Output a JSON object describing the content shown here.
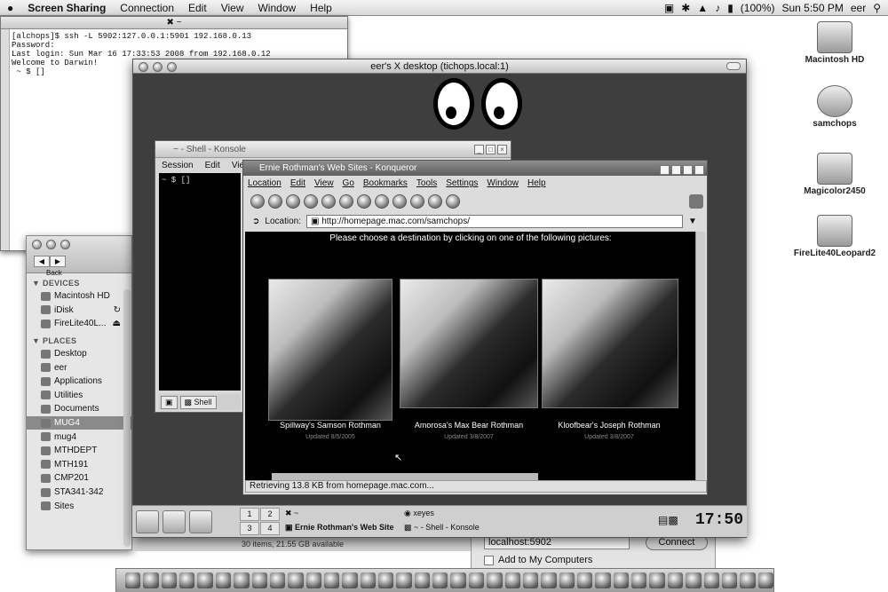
{
  "menubar": {
    "apple": "",
    "app": "Screen Sharing",
    "items": [
      "Connection",
      "Edit",
      "View",
      "Window",
      "Help"
    ],
    "battery": "(100%)",
    "clock": "Sun 5:50 PM",
    "user": "eer"
  },
  "desktop_icons": [
    "Macintosh HD",
    "samchops",
    "Magicolor2450",
    "FireLite40Leopard2"
  ],
  "xterm": {
    "title": "~",
    "lines": "[alchops]$ ssh -L 5902:127.0.0.1:5901 192.168.0.13\nPassword:\nLast login: Sun Mar 16 17:33:53 2008 from 192.168.0.12\nWelcome to Darwin!\n ~ $ []"
  },
  "finder": {
    "back_label": "Back",
    "devices_header": "DEVICES",
    "devices": [
      "Macintosh HD",
      "iDisk",
      "FireLite40L..."
    ],
    "places_header": "PLACES",
    "places": [
      "Desktop",
      "eer",
      "Applications",
      "Utilities",
      "Documents",
      "MUG4",
      "mug4",
      "MTHDEPT",
      "MTH191",
      "CMP201",
      "STA341-342",
      "Sites"
    ],
    "status": "30 items, 21.55 GB available"
  },
  "ss_dialog": {
    "host": "localhost:5902",
    "connect": "Connect",
    "checkbox": "Add to My Computers"
  },
  "xwindow": {
    "title": "eer's X desktop (tichops.local:1)"
  },
  "konsole": {
    "title": "~ - Shell - Konsole",
    "menu": [
      "Session",
      "Edit",
      "View"
    ],
    "prompt": "~ $ []",
    "tab": "Shell"
  },
  "konqueror": {
    "title": "Ernie Rothman's Web Sites - Konqueror",
    "menu": [
      "Location",
      "Edit",
      "View",
      "Go",
      "Bookmarks",
      "Tools",
      "Settings",
      "Window",
      "Help"
    ],
    "location_label": "Location:",
    "url": "http://homepage.mac.com/samchops/",
    "heading": "Please choose a destination by clicking on one of the following pictures:",
    "dogs": [
      {
        "name": "Spillway's Samson Rothman",
        "updated": "Updated 8/5/2005"
      },
      {
        "name": "Amorosa's Max Bear Rothman",
        "updated": "Updated 3/8/2007"
      },
      {
        "name": "Kloofbear's Joseph Rothman",
        "updated": "Updated 3/8/2007"
      }
    ],
    "status": "Retrieving 13.8 KB from homepage.mac.com..."
  },
  "kpanel": {
    "pager": [
      "1",
      "2",
      "3",
      "4"
    ],
    "task_xterm": "~",
    "task_xeyes": "xeyes",
    "task_konq": "Ernie Rothman's Web Site",
    "task_konsole": "~ - Shell - Konsole",
    "clock": "17:50"
  }
}
